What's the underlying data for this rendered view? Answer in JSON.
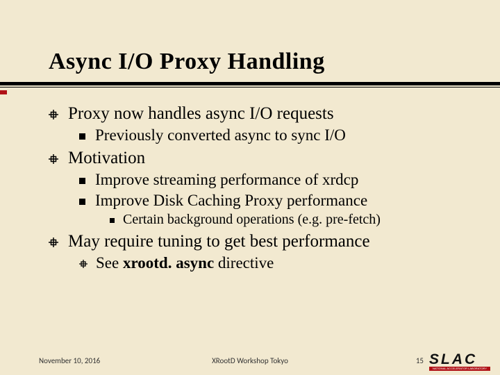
{
  "title": "Async I/O Proxy Handling",
  "bullets": {
    "b1": "Proxy now handles async I/O requests",
    "b1a": "Previously converted async to sync I/O",
    "b2": "Motivation",
    "b2a": "Improve streaming performance of xrdcp",
    "b2b": "Improve Disk Caching Proxy performance",
    "b2b1": "Certain background operations (e.g. pre-fetch)",
    "b3": "May require tuning to get best performance",
    "b3a_pre": "See ",
    "b3a_bold": "xrootd. async",
    "b3a_post": " directive"
  },
  "footer": {
    "date": "November 10, 2016",
    "center": "XRootD Workshop Tokyo",
    "page": "15"
  },
  "logo": {
    "text": "SLAC",
    "sub": "NATIONAL ACCELERATOR LABORATORY"
  }
}
